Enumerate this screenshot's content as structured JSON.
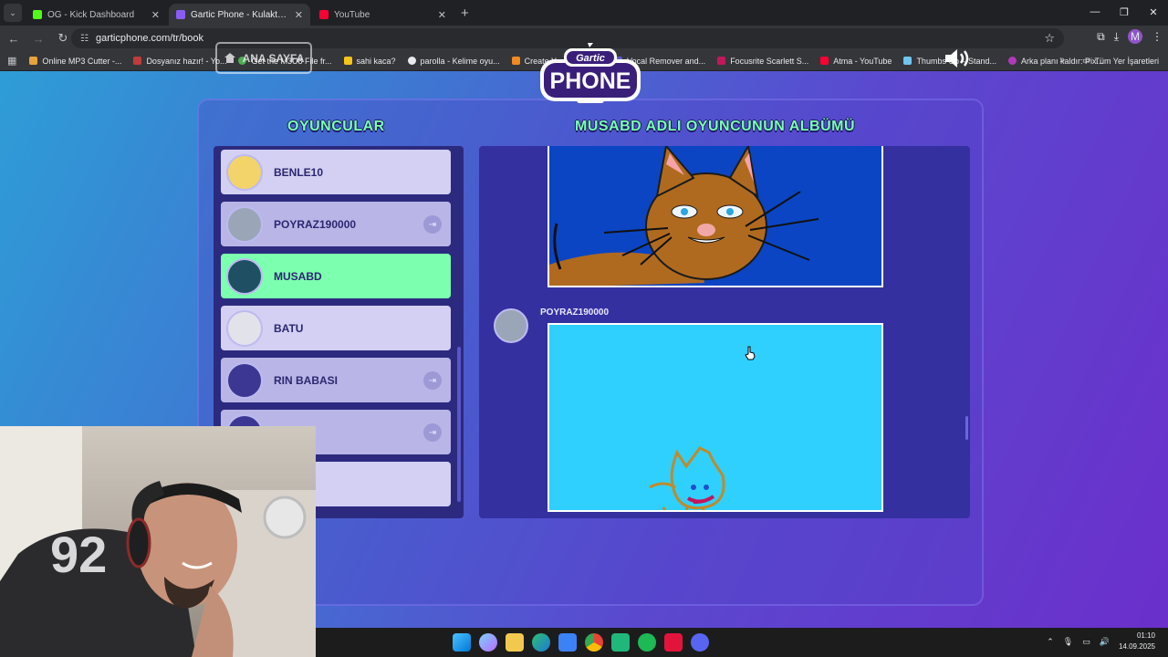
{
  "browser": {
    "tabs": [
      {
        "title": "OG - Kick Dashboard",
        "active": false,
        "favicon_color": "#53fc18"
      },
      {
        "title": "Gartic Phone - Kulaktan Kulağa",
        "active": true,
        "favicon_color": "#8a5cf6"
      },
      {
        "title": "YouTube",
        "active": false,
        "favicon_color": "#ff0033"
      }
    ],
    "url": "garticphone.com/tr/book",
    "bookmarks": [
      {
        "label": "Online MP3 Cutter -...",
        "color": "#e8a33d"
      },
      {
        "label": "Dosyanız hazır! - Yo...",
        "color": "#c23b3b"
      },
      {
        "label": "Get the M3U8 File fr...",
        "color": "#4caf50"
      },
      {
        "label": "sahi kaca?",
        "color": "#f5c518"
      },
      {
        "label": "parolla - Kelime oyu...",
        "color": "#e8eaed"
      },
      {
        "label": "Create Your Best M...",
        "color": "#f08a24"
      },
      {
        "label": "Vocal Remover and...",
        "color": "#5b5fc7"
      },
      {
        "label": "Focusrite Scarlett S...",
        "color": "#c2185b"
      },
      {
        "label": "Atma - YouTube",
        "color": "#ff0033"
      },
      {
        "label": "Thumbs Up – Stand...",
        "color": "#6ec6f0"
      },
      {
        "label": "Arka planı kaldır: Pix...",
        "color": "#b03ab8"
      }
    ],
    "all_bookmarks": "Tüm Yer İşaretleri",
    "profile_initial": "M"
  },
  "game": {
    "home_label": "ANA SAYFA",
    "logo_line1": "Gartic",
    "logo_line2": "PHONE",
    "players_heading": "OYUNCULAR",
    "album_heading": "MUSABD ADLI OYUNCUNUN ALBÜMÜ",
    "players": [
      {
        "name": "BENLE10",
        "state": "normal",
        "kick": false
      },
      {
        "name": "POYRAZ190000",
        "state": "dim",
        "kick": true
      },
      {
        "name": "MUSABD",
        "state": "active",
        "kick": false
      },
      {
        "name": "BATU",
        "state": "normal",
        "kick": false
      },
      {
        "name": "RIN BABASI",
        "state": "dim",
        "kick": true
      },
      {
        "name": "",
        "state": "dim",
        "kick": true
      },
      {
        "name": "",
        "state": "normal",
        "kick": false
      }
    ],
    "album_author": "POYRAZ190000"
  },
  "taskbar": {
    "time": "01:10",
    "date": "14.09.2025"
  }
}
